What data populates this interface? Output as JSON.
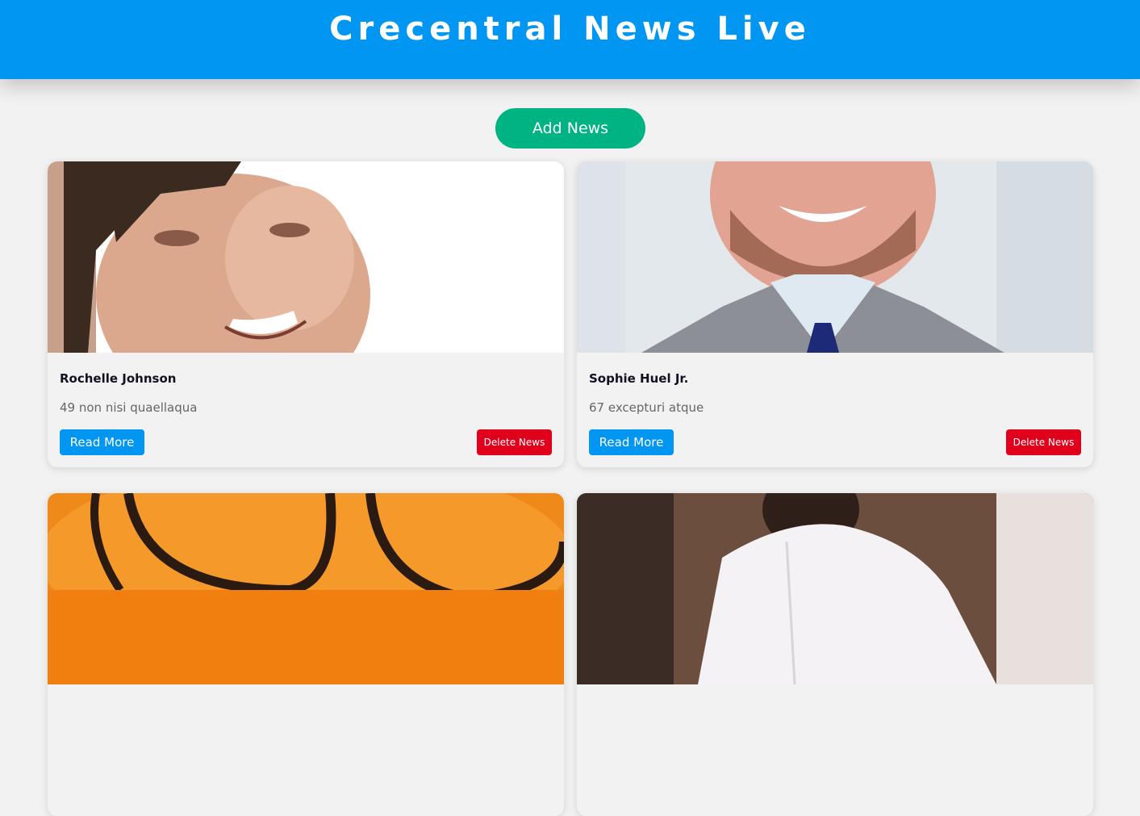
{
  "header": {
    "title": "Crecentral News Live",
    "color": "#0096f2"
  },
  "actions": {
    "add_news_label": "Add News",
    "add_news_color": "#00b383"
  },
  "news": [
    {
      "name": "Rochelle Johnson",
      "description": "49 non nisi quaellaqua",
      "read_more_label": "Read More",
      "delete_label": "Delete News",
      "image_icon": "person-photo"
    },
    {
      "name": "Sophie Huel Jr.",
      "description": "67 excepturi atque",
      "read_more_label": "Read More",
      "delete_label": "Delete News",
      "image_icon": "person-photo"
    },
    {
      "name": "",
      "description": "",
      "read_more_label": "",
      "delete_label": "",
      "image_icon": "person-photo"
    },
    {
      "name": "",
      "description": "",
      "read_more_label": "",
      "delete_label": "",
      "image_icon": "person-photo"
    }
  ],
  "colors": {
    "read_more": "#0096f2",
    "delete": "#e0001b",
    "background": "#f2f2f2"
  }
}
